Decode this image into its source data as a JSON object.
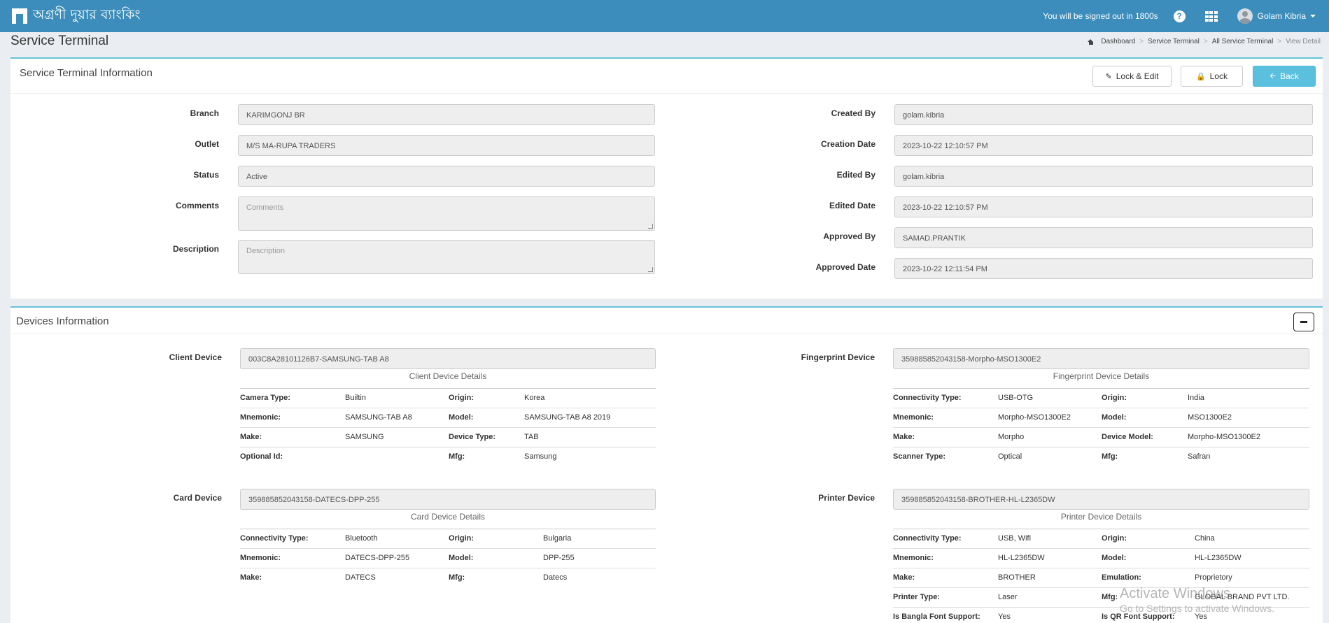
{
  "header": {
    "brand": "অগ্রণী দুয়ার ব্যাংকিং",
    "signout_text": "You will be signed out in 1800s",
    "username": "Golam Kibria"
  },
  "page": {
    "title": "Service Terminal",
    "breadcrumb": [
      "Dashboard",
      "Service Terminal",
      "All Service Terminal",
      "View Detail"
    ]
  },
  "info_box": {
    "title": "Service Terminal Information",
    "buttons": {
      "lock_edit": "Lock & Edit",
      "lock": "Lock",
      "back": "Back"
    },
    "left_fields": [
      {
        "label": "Branch",
        "value": "KARIMGONJ BR"
      },
      {
        "label": "Outlet",
        "value": "M/S MA-RUPA TRADERS"
      },
      {
        "label": "Status",
        "value": "Active"
      },
      {
        "label": "Comments",
        "placeholder": "Comments"
      },
      {
        "label": "Description",
        "placeholder": "Description"
      }
    ],
    "right_fields": [
      {
        "label": "Created By",
        "value": "golam.kibria"
      },
      {
        "label": "Creation Date",
        "value": "2023-10-22 12:10:57 PM"
      },
      {
        "label": "Edited By",
        "value": "golam.kibria"
      },
      {
        "label": "Edited Date",
        "value": "2023-10-22 12:10:57 PM"
      },
      {
        "label": "Approved By",
        "value": "SAMAD.PRANTIK"
      },
      {
        "label": "Approved Date",
        "value": "2023-10-22 12:11:54 PM"
      }
    ]
  },
  "devices_box": {
    "title": "Devices Information",
    "client": {
      "label": "Client Device",
      "value": "003C8A28101126B7-SAMSUNG-TAB A8",
      "details_title": "Client Device Details",
      "rows": [
        [
          "Camera Type:",
          "Builtin",
          "Origin:",
          "Korea"
        ],
        [
          "Mnemonic:",
          "SAMSUNG-TAB A8",
          "Model:",
          "SAMSUNG-TAB A8 2019"
        ],
        [
          "Make:",
          "SAMSUNG",
          "Device Type:",
          "TAB"
        ],
        [
          "Optional Id:",
          "",
          "Mfg:",
          "Samsung"
        ]
      ]
    },
    "fingerprint": {
      "label": "Fingerprint Device",
      "value": "359885852043158-Morpho-MSO1300E2",
      "details_title": "Fingerprint Device Details",
      "rows": [
        [
          "Connectivity Type:",
          "USB-OTG",
          "Origin:",
          "India"
        ],
        [
          "Mnemonic:",
          "Morpho-MSO1300E2",
          "Model:",
          "MSO1300E2"
        ],
        [
          "Make:",
          "Morpho",
          "Device Model:",
          "Morpho-MSO1300E2"
        ],
        [
          "Scanner Type:",
          "Optical",
          "Mfg:",
          "Safran"
        ]
      ]
    },
    "card": {
      "label": "Card Device",
      "value": "359885852043158-DATECS-DPP-255",
      "details_title": "Card Device Details",
      "rows": [
        [
          "Connectivity Type:",
          "Bluetooth",
          "Origin:",
          "Bulgaria"
        ],
        [
          "Mnemonic:",
          "DATECS-DPP-255",
          "Model:",
          "DPP-255"
        ],
        [
          "Make:",
          "DATECS",
          "Mfg:",
          "Datecs"
        ]
      ]
    },
    "printer": {
      "label": "Printer Device",
      "value": "359885852043158-BROTHER-HL-L2365DW",
      "details_title": "Printer Device Details",
      "rows": [
        [
          "Connectivity Type:",
          "USB, Wifi",
          "Origin:",
          "China"
        ],
        [
          "Mnemonic:",
          "HL-L2365DW",
          "Model:",
          "HL-L2365DW"
        ],
        [
          "Make:",
          "BROTHER",
          "Emulation:",
          "Proprietory"
        ],
        [
          "Printer Type:",
          "Laser",
          "Mfg:",
          "GLOBAL BRAND PVT LTD."
        ],
        [
          "Is Bangla Font Support:",
          "Yes",
          "Is QR Font Support:",
          "Yes"
        ]
      ]
    }
  },
  "watermark": {
    "line1": "Activate Windows",
    "line2": "Go to Settings to activate Windows."
  }
}
